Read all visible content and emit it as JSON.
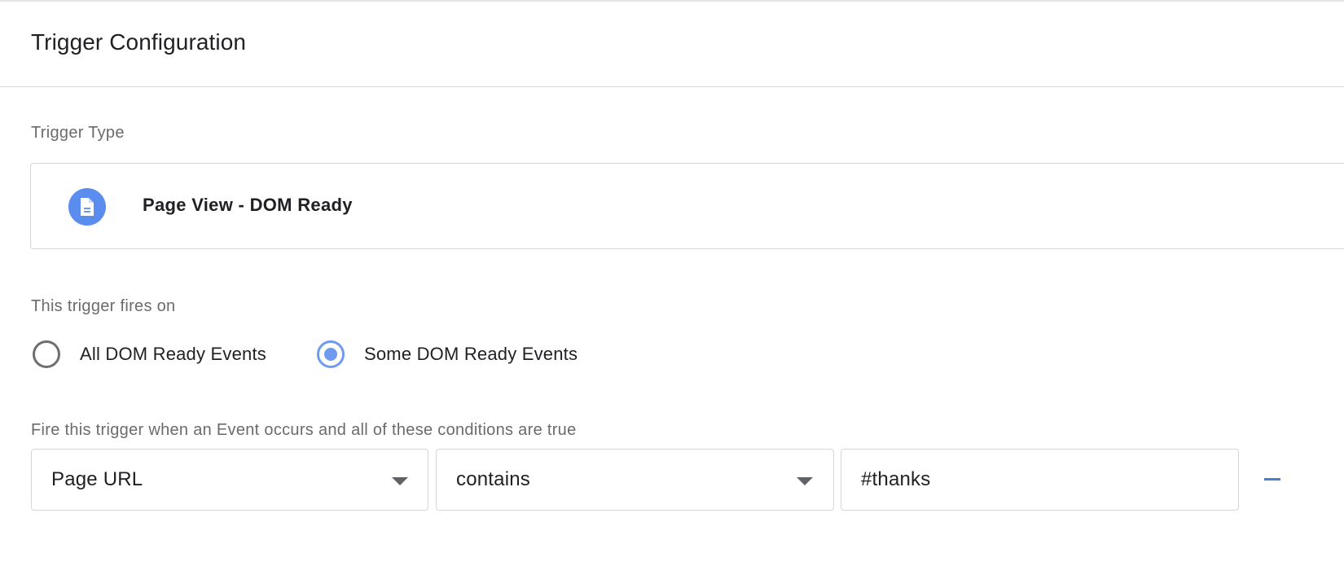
{
  "card": {
    "title": "Trigger Configuration"
  },
  "trigger_type": {
    "label": "Trigger Type",
    "icon": "document-icon",
    "icon_color": "#5b8def",
    "name": "Page View - DOM Ready"
  },
  "fires_on": {
    "label": "This trigger fires on",
    "options": [
      {
        "label": "All DOM Ready Events",
        "selected": false
      },
      {
        "label": "Some DOM Ready Events",
        "selected": true
      }
    ],
    "accent_color": "#6f9bef"
  },
  "conditions": {
    "label": "Fire this trigger when an Event occurs and all of these conditions are true",
    "rows": [
      {
        "variable": "Page URL",
        "operator": "contains",
        "value": "#thanks"
      }
    ]
  }
}
